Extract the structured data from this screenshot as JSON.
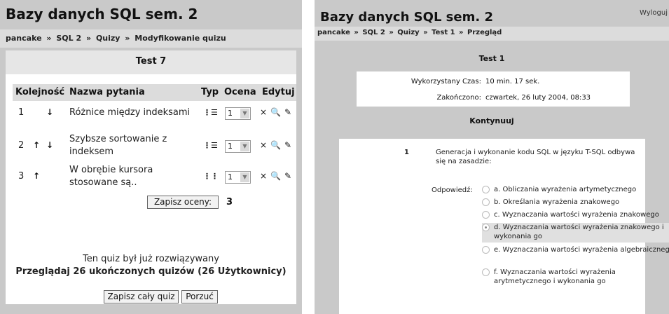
{
  "left": {
    "title": "Bazy danych SQL sem. 2",
    "breadcrumb": [
      "pancake",
      "»",
      "SQL 2",
      "»",
      "Quizy",
      "»",
      "Modyfikowanie quizu"
    ],
    "quiz_name": "Test 7",
    "columns": [
      "Kolejność",
      "Nazwa pytania",
      "Typ",
      "Ocena",
      "Edytuj"
    ],
    "rows": [
      {
        "num": "1",
        "up": "",
        "down": "↓",
        "name": "Różnice między indeksami",
        "type_icon": "multichoice-icon",
        "type_glyph": "⋮☰",
        "grade": "1"
      },
      {
        "num": "2",
        "up": "↑",
        "down": "↓",
        "name": "Szybsze sortowanie z indeksem",
        "type_icon": "multichoice-icon",
        "type_glyph": "⋮☰",
        "grade": "1"
      },
      {
        "num": "3",
        "up": "↑",
        "down": "",
        "name": "W obrębie kursora stosowane są..",
        "type_icon": "multichoice-icon",
        "type_glyph": "⋮⋮",
        "grade": "1"
      }
    ],
    "edit_icons": {
      "delete": "×",
      "preview": "🔍",
      "edit": "✎"
    },
    "save_grades_label": "Zapisz oceny:",
    "total_grade": "3",
    "attempted_note": "Ten quiz był już rozwiązywany",
    "review_link": "Przeglądaj 26 ukończonych quizów (26 Użytkownicy)",
    "save_quiz_label": "Zapisz cały quiz",
    "cancel_label": "Porzuć"
  },
  "right": {
    "title": "Bazy danych SQL sem. 2",
    "logout": "Wyloguj",
    "breadcrumb": [
      "pancake",
      "»",
      "SQL 2",
      "»",
      "Quizy",
      "»",
      "Test 1",
      "»",
      "Przegląd"
    ],
    "quiz_name": "Test 1",
    "time_used_label": "Wykorzystany Czas:",
    "time_used_value": "10 min. 17 sek.",
    "finished_label": "Zakończono:",
    "finished_value": "czwartek, 26 luty 2004, 08:33",
    "continue_label": "Kontynuuj",
    "question_number": "1",
    "question_text": "Generacja i wykonanie kodu SQL w języku T-SQL odbywa się na zasadzie:",
    "answer_label": "Odpowiedź:",
    "options": [
      {
        "text": "a. Obliczania wyrażenia artymetycznego",
        "selected": false
      },
      {
        "text": "b. Określania wyrażenia znakowego",
        "selected": false
      },
      {
        "text": "c. Wyznaczania wartości wyrażenia znakowego",
        "selected": false
      },
      {
        "text": "d. Wyznaczania wartości wyrażenia znakowego i wykonania go",
        "selected": true
      },
      {
        "text": "e. Wyznaczania wartości wyrażenia algebraicznego",
        "selected": false
      },
      {
        "text": "f. Wyznaczania wartości wyrażenia arytmetycznego i wykonania go",
        "selected": false
      }
    ]
  }
}
